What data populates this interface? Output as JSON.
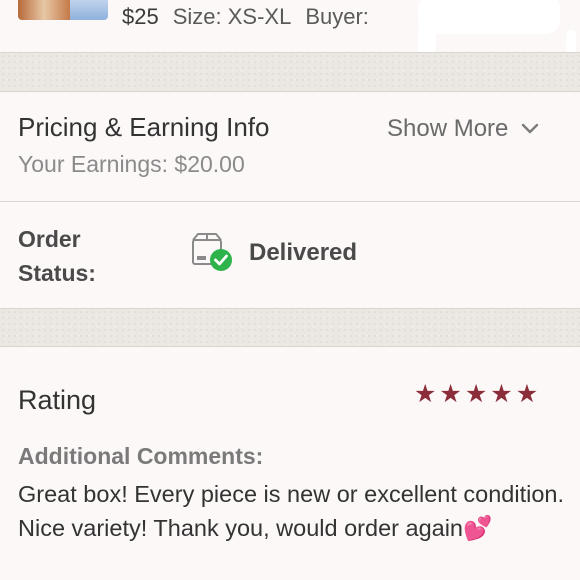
{
  "listing": {
    "price": "$25",
    "size": "Size: XS-XL",
    "buyer_label": "Buyer:"
  },
  "pricing": {
    "title": "Pricing & Earning Info",
    "earnings": "Your Earnings: $20.00",
    "show_more": "Show More"
  },
  "order": {
    "label_line1": "Order",
    "label_line2": "Status:",
    "status": "Delivered"
  },
  "rating": {
    "title": "Rating",
    "stars": 5,
    "star_glyph": "★",
    "comments_label": "Additional Comments:",
    "comments_text": "Great box! Every piece is new or excellent condition. Nice variety! Thank you, would order again",
    "comments_emoji": "💕"
  },
  "colors": {
    "star": "#8c2d3a",
    "delivered_check": "#2db34a"
  }
}
